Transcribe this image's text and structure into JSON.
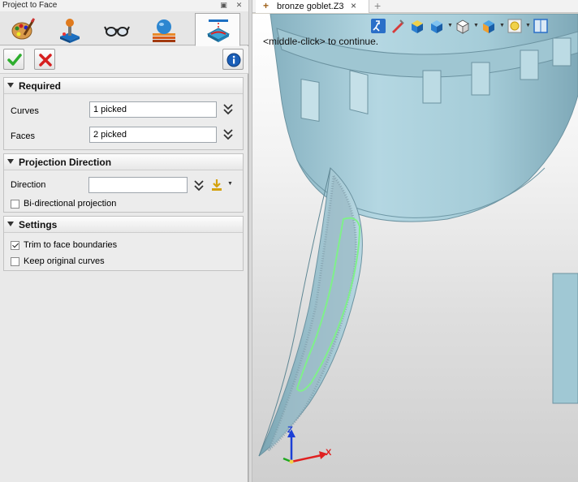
{
  "panel": {
    "title": "Project to Face",
    "mode_tabs": [
      {
        "icon": "palette-icon"
      },
      {
        "icon": "joystick-icon"
      },
      {
        "icon": "glasses-icon"
      },
      {
        "icon": "layers-sphere-icon"
      },
      {
        "icon": "project-to-face-icon",
        "active": true
      }
    ]
  },
  "actions": {
    "ok_icon": "checkmark-icon",
    "cancel_icon": "cancel-x-icon",
    "info_icon": "info-icon"
  },
  "required": {
    "title": "Required",
    "curves_label": "Curves",
    "curves_value": "1 picked",
    "faces_label": "Faces",
    "faces_value": "2 picked"
  },
  "projection": {
    "title": "Projection Direction",
    "direction_label": "Direction",
    "direction_value": "",
    "bidirectional_label": "Bi-directional projection",
    "bidirectional_checked": false
  },
  "settings": {
    "title": "Settings",
    "trim_label": "Trim to face boundaries",
    "trim_checked": true,
    "keep_label": "Keep original curves",
    "keep_checked": false
  },
  "document": {
    "tab_title": "bronze goblet.Z3",
    "close_glyph": "×",
    "add_glyph": "+"
  },
  "viewport": {
    "hint": "<middle-click> to continue.",
    "axis_labels": {
      "z": "Z",
      "x": "X"
    },
    "model_color": "#a9d0dc",
    "curve_color": "#7ff08a"
  }
}
